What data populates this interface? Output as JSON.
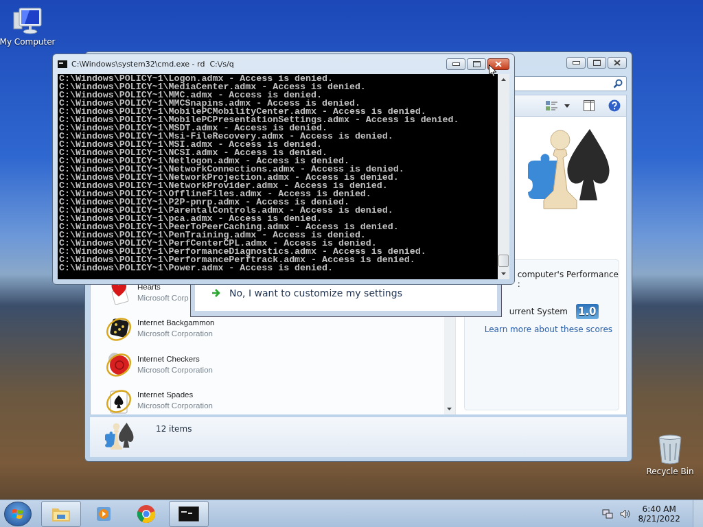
{
  "desktop_icons": [
    {
      "kind": "computer",
      "label": "My Computer"
    },
    {
      "kind": "recycle",
      "label": "Recycle Bin"
    }
  ],
  "games_window": {
    "games": [
      {
        "kind": "hearts",
        "name": "Hearts",
        "publisher": "Microsoft Corp"
      },
      {
        "kind": "backgammon",
        "name": "Internet Backgammon",
        "publisher": "Microsoft Corporation"
      },
      {
        "kind": "checkers",
        "name": "Internet Checkers",
        "publisher": "Microsoft Corporation"
      },
      {
        "kind": "spades",
        "name": "Internet Spades",
        "publisher": "Microsoft Corporation"
      }
    ],
    "performance": {
      "heading": "computer's Performance",
      "heading_rest": ":",
      "system_label": "urrent System",
      "score": "1.0",
      "link": "Learn more about these scores"
    },
    "status": "12 items"
  },
  "dialog": {
    "option": "No, I want to customize my settings"
  },
  "console_window": {
    "title": "C:\\Windows\\system32\\cmd.exe - rd  C:\\/s/q",
    "lines": [
      "C:\\Windows\\POLICY~1\\Logon.admx - Access is denied.",
      "C:\\Windows\\POLICY~1\\MediaCenter.admx - Access is denied.",
      "C:\\Windows\\POLICY~1\\MMC.admx - Access is denied.",
      "C:\\Windows\\POLICY~1\\MMCSnapins.admx - Access is denied.",
      "C:\\Windows\\POLICY~1\\MobilePCMobilityCenter.admx - Access is denied.",
      "C:\\Windows\\POLICY~1\\MobilePCPresentationSettings.admx - Access is denied.",
      "C:\\Windows\\POLICY~1\\MSDT.admx - Access is denied.",
      "C:\\Windows\\POLICY~1\\Msi-FileRecovery.admx - Access is denied.",
      "C:\\Windows\\POLICY~1\\MSI.admx - Access is denied.",
      "C:\\Windows\\POLICY~1\\NCSI.admx - Access is denied.",
      "C:\\Windows\\POLICY~1\\Netlogon.admx - Access is denied.",
      "C:\\Windows\\POLICY~1\\NetworkConnections.admx - Access is denied.",
      "C:\\Windows\\POLICY~1\\NetworkProjection.admx - Access is denied.",
      "C:\\Windows\\POLICY~1\\NetworkProvider.admx - Access is denied.",
      "C:\\Windows\\POLICY~1\\OfflineFiles.admx - Access is denied.",
      "C:\\Windows\\POLICY~1\\P2P-pnrp.admx - Access is denied.",
      "C:\\Windows\\POLICY~1\\ParentalControls.admx - Access is denied.",
      "C:\\Windows\\POLICY~1\\pca.admx - Access is denied.",
      "C:\\Windows\\POLICY~1\\PeerToPeerCaching.admx - Access is denied.",
      "C:\\Windows\\POLICY~1\\PenTraining.admx - Access is denied.",
      "C:\\Windows\\POLICY~1\\PerfCenterCPL.admx - Access is denied.",
      "C:\\Windows\\POLICY~1\\PerformanceDiagnostics.admx - Access is denied.",
      "C:\\Windows\\POLICY~1\\PerformancePerftrack.admx - Access is denied.",
      "C:\\Windows\\POLICY~1\\Power.admx - Access is denied."
    ]
  },
  "taskbar": {
    "buttons": [
      {
        "kind": "explorer",
        "open": true
      },
      {
        "kind": "media",
        "open": false
      },
      {
        "kind": "chrome",
        "open": false
      },
      {
        "kind": "console",
        "open": true
      }
    ],
    "time": "6:40 AM",
    "date": "8/21/2022"
  }
}
